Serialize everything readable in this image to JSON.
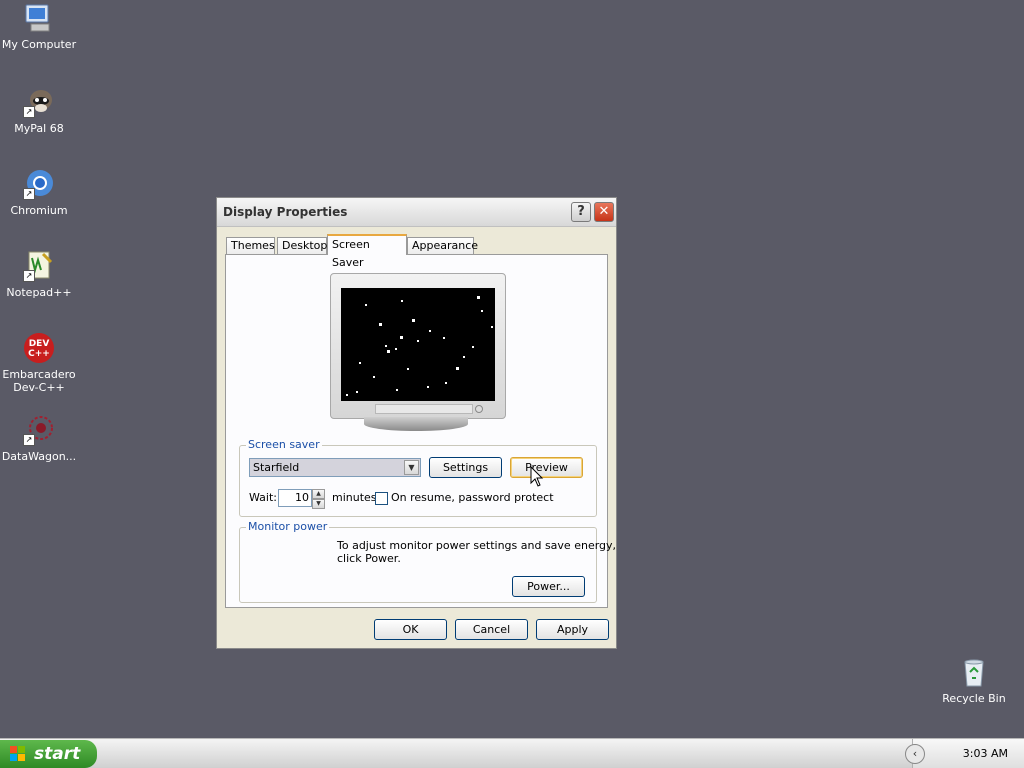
{
  "desktop": {
    "icons": [
      {
        "label": "My Computer",
        "name": "my-computer-icon"
      },
      {
        "label": "MyPal 68",
        "name": "mypal-icon"
      },
      {
        "label": "Chromium",
        "name": "chromium-icon"
      },
      {
        "label": "Notepad++",
        "name": "notepadpp-icon"
      },
      {
        "label_line1": "Embarcadero",
        "label_line2": "Dev-C++",
        "name": "devcpp-icon"
      },
      {
        "label": "DataWagon...",
        "name": "datawagon-icon"
      },
      {
        "label": "Recycle Bin",
        "name": "recycle-bin-icon"
      }
    ]
  },
  "dialog": {
    "title": "Display Properties",
    "help_button": "?",
    "close_button": "✕",
    "tabs": [
      "Themes",
      "Desktop",
      "Screen Saver",
      "Appearance"
    ],
    "active_tab": "Screen Saver",
    "screensaver_group": {
      "label": "Screen saver",
      "selected": "Starfield",
      "settings_button": "Settings",
      "preview_button": "Preview",
      "wait_label": "Wait:",
      "wait_value": "10",
      "minutes_label": "minutes",
      "password_label": "On resume, password protect",
      "password_checked": false
    },
    "monitor_group": {
      "label": "Monitor power",
      "description_line1": "To adjust monitor power settings and save energy,",
      "description_line2": "click Power.",
      "power_button": "Power..."
    },
    "ok_button": "OK",
    "cancel_button": "Cancel",
    "apply_button": "Apply"
  },
  "taskbar": {
    "start_label": "start",
    "clock": "3:03 AM"
  },
  "colors": {
    "desktop_bg": "#5a5a66",
    "group_label": "#1b4fa7",
    "start_green": "#3a9a2e",
    "active_tab_accent": "#e8a840"
  }
}
